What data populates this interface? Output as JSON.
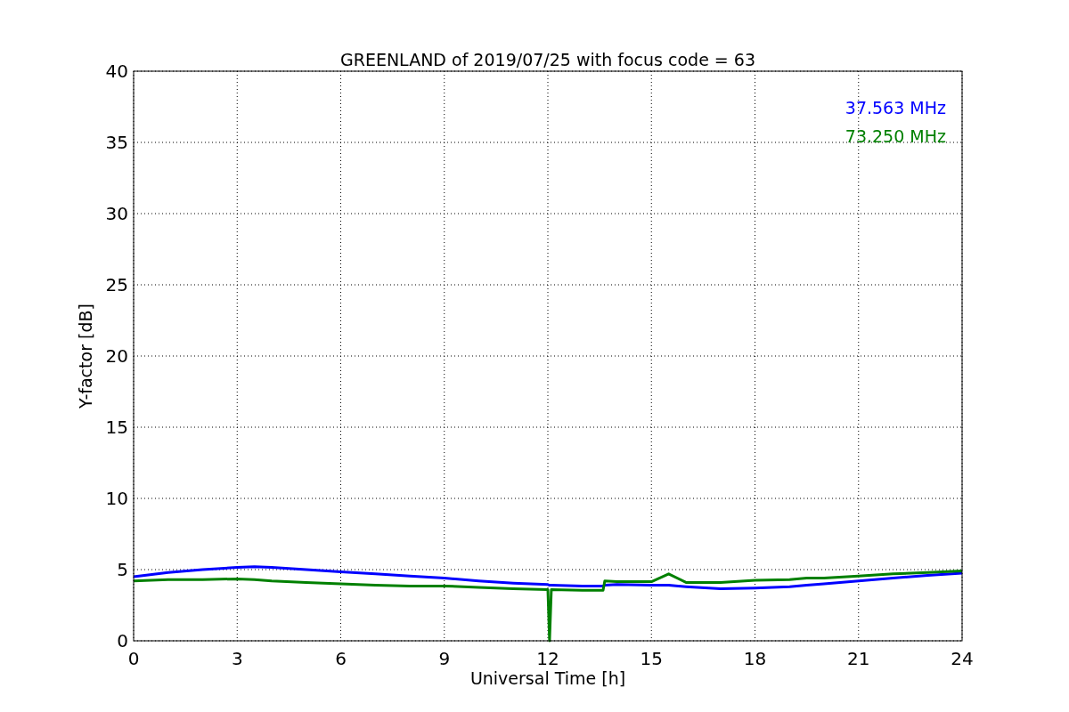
{
  "chart_data": {
    "type": "line",
    "title": "GREENLAND of 2019/07/25 with focus code = 63",
    "xlabel": "Universal Time [h]",
    "ylabel": "Y-factor [dB]",
    "x": [
      0,
      1,
      2,
      3,
      3.5,
      4,
      5,
      6,
      7,
      8,
      9,
      10,
      11,
      12,
      12.05,
      12.1,
      13,
      13.6,
      13.65,
      14,
      15,
      15.5,
      16,
      17,
      18,
      19,
      19.5,
      20,
      21,
      22,
      23,
      24
    ],
    "series": [
      {
        "name": "37.563 MHz",
        "color": "#0000ff",
        "values": [
          4.5,
          4.8,
          5.0,
          5.15,
          5.2,
          5.15,
          5.0,
          4.85,
          4.7,
          4.55,
          4.4,
          4.2,
          4.05,
          3.95,
          3.9,
          3.9,
          3.85,
          3.85,
          3.9,
          3.95,
          3.9,
          3.9,
          3.8,
          3.65,
          3.7,
          3.8,
          3.9,
          4.0,
          4.2,
          4.4,
          4.6,
          4.75
        ]
      },
      {
        "name": "73.250 MHz",
        "color": "#008000",
        "values": [
          4.2,
          4.3,
          4.3,
          4.35,
          4.3,
          4.2,
          4.1,
          4.0,
          3.9,
          3.85,
          3.85,
          3.75,
          3.65,
          3.6,
          0,
          3.6,
          3.55,
          3.55,
          4.2,
          4.15,
          4.15,
          4.7,
          4.1,
          4.1,
          4.25,
          4.3,
          4.4,
          4.4,
          4.55,
          4.7,
          4.8,
          4.9
        ]
      }
    ],
    "grid": true,
    "xlim": [
      0,
      24
    ],
    "ylim": [
      0,
      40
    ],
    "xticks": [
      0,
      3,
      6,
      9,
      12,
      15,
      18,
      21,
      24
    ],
    "yticks": [
      0,
      5,
      10,
      15,
      20,
      25,
      30,
      35,
      40
    ]
  }
}
